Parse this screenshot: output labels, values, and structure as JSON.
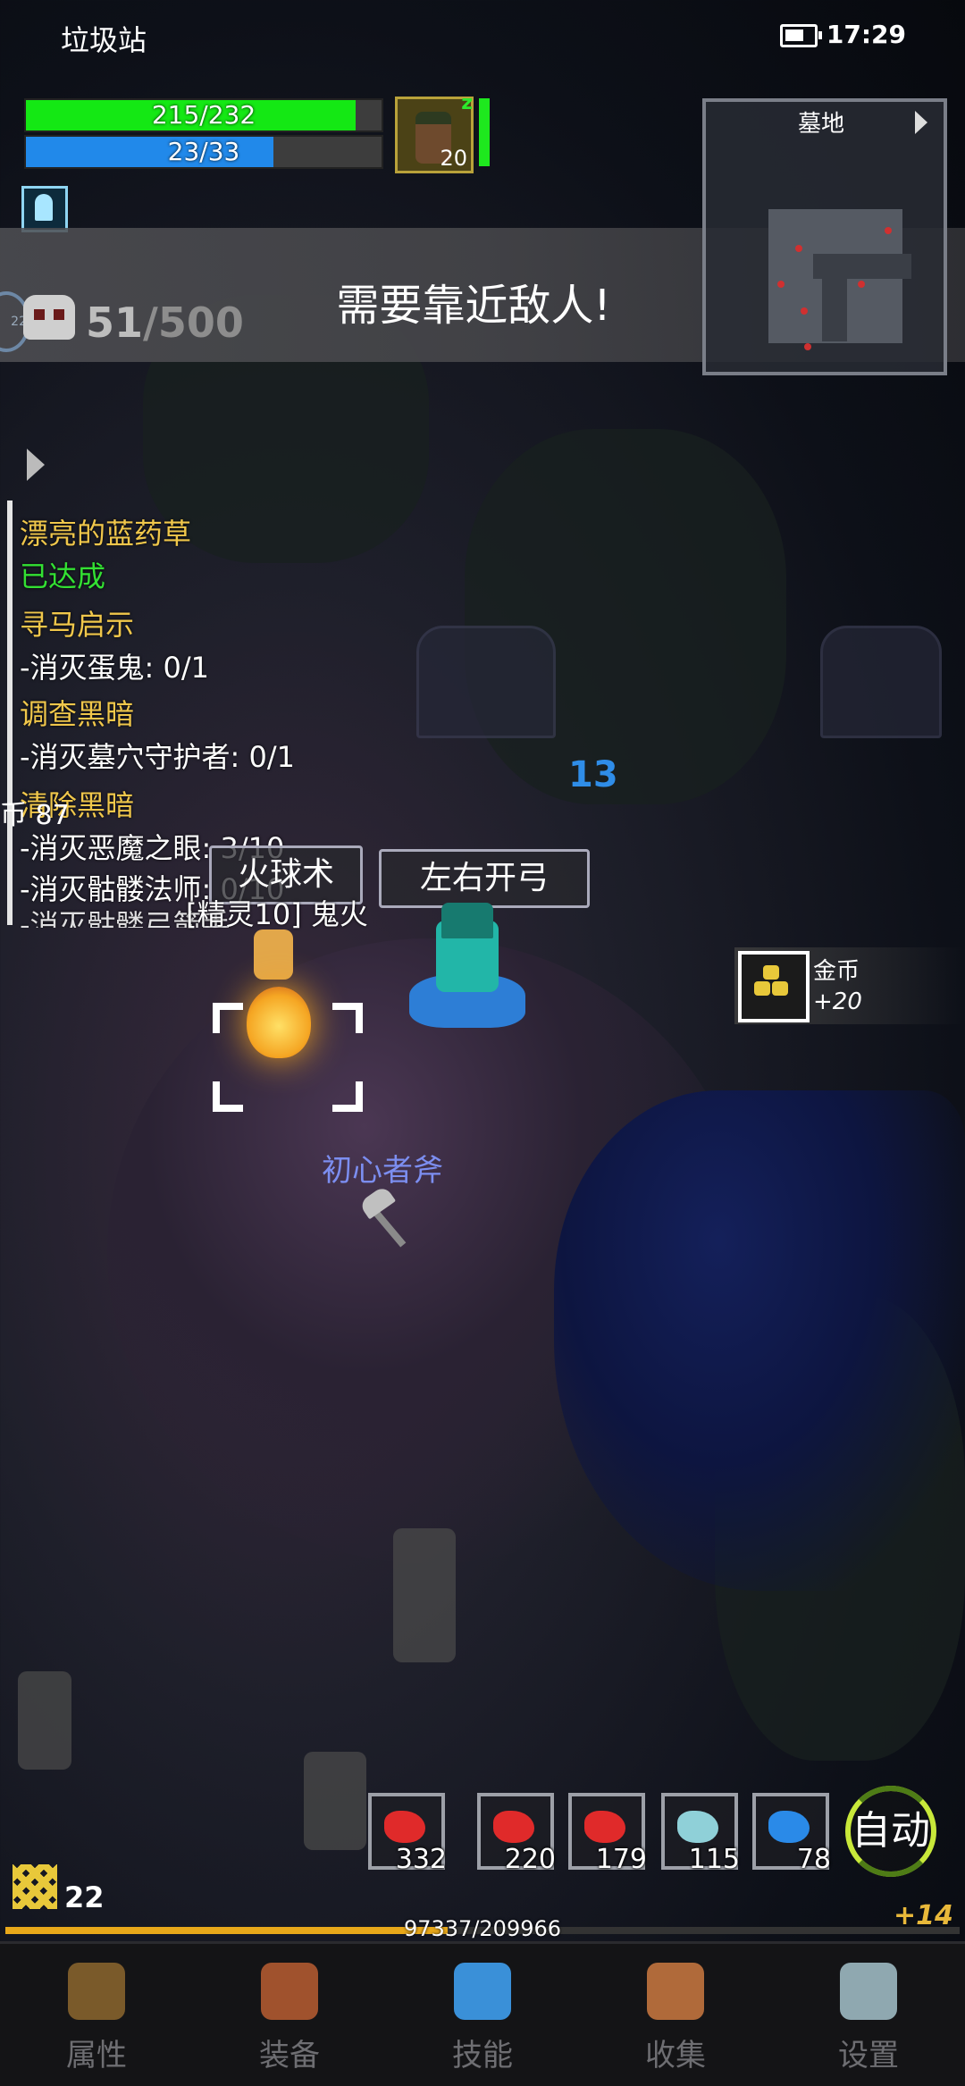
{
  "status_bar": {
    "title": "垃圾站",
    "time": "17:29"
  },
  "player": {
    "hp": {
      "current": 215,
      "max": 232,
      "text": "215/232",
      "color": "#14e814"
    },
    "mp": {
      "current": 23,
      "max": 33,
      "text": "23/33",
      "color": "#2189ea"
    },
    "level": "20"
  },
  "banner": {
    "message": "需要靠近敌人!"
  },
  "kills": {
    "current": "51",
    "max": "/500",
    "badge": "22"
  },
  "minimap": {
    "title": "墓地"
  },
  "quests": [
    {
      "title": "漂亮的蓝药草",
      "status": "已达成"
    },
    {
      "title": "寻马启示",
      "objectives": [
        "-消灭蛋鬼: 0/1"
      ]
    },
    {
      "title": "调查黑暗",
      "objectives": [
        "-消灭墓穴守护者: 0/1"
      ]
    },
    {
      "title": "清除黑暗",
      "objectives": [
        "-消灭恶魔之眼: 3/10",
        "-消灭骷髅法师: 0/10",
        "-消灭骷髅弓箭手"
      ]
    }
  ],
  "side_left_text": "币 87",
  "skills": [
    {
      "label": "火球术"
    },
    {
      "label": "左右开弓"
    }
  ],
  "pet_label": "[精灵10] 鬼火",
  "damage_number": "13",
  "pickup": {
    "name": "金币",
    "amount": "+20"
  },
  "ground_item": "初心者斧",
  "potions": [
    {
      "count": "332",
      "color": "#e02a2a"
    },
    {
      "count": "220",
      "color": "#e02a2a"
    },
    {
      "count": "179",
      "color": "#e02a2a"
    },
    {
      "count": "115",
      "color": "#8fd0d8"
    },
    {
      "count": "78",
      "color": "#2a8ae8"
    }
  ],
  "auto_button": "自动",
  "experience": {
    "level": "22",
    "current": 97337,
    "max": 209966,
    "text": "97337/209966",
    "gain": "+14"
  },
  "nav": [
    {
      "label": "属性",
      "icon": "helmet-icon",
      "color": "#7a5a2a"
    },
    {
      "label": "装备",
      "icon": "bag-icon",
      "color": "#a0522d"
    },
    {
      "label": "技能",
      "icon": "gear-star-icon",
      "color": "#3a90d8"
    },
    {
      "label": "收集",
      "icon": "book-icon",
      "color": "#b06a3a"
    },
    {
      "label": "设置",
      "icon": "settings-icon",
      "color": "#8fa8b0"
    }
  ]
}
